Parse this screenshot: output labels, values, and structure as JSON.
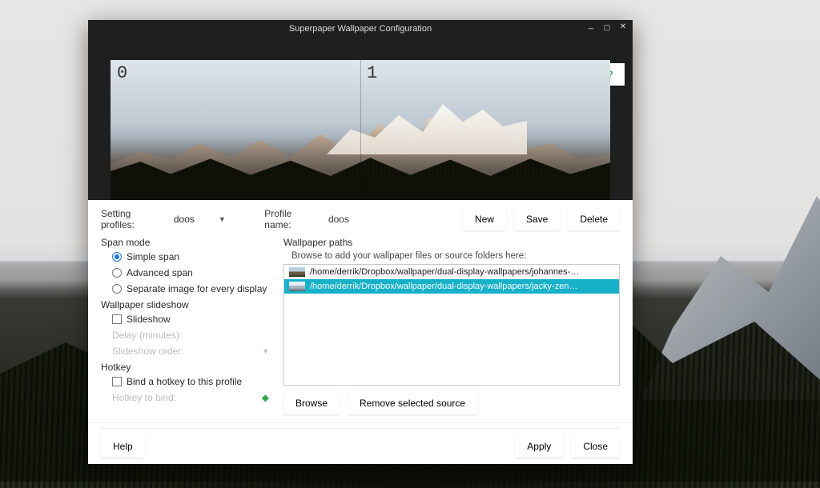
{
  "window": {
    "title": "Superpaper Wallpaper Configuration"
  },
  "preview": {
    "monitor_labels": [
      "0",
      "1"
    ],
    "help_icon": "?"
  },
  "profiles": {
    "label": "Setting profiles:",
    "selected": "doos",
    "name_label": "Profile name:",
    "name_value": "doos",
    "buttons": {
      "new": "New",
      "save": "Save",
      "delete": "Delete"
    }
  },
  "span": {
    "group_label": "Span mode",
    "options": [
      {
        "label": "Simple span",
        "selected": true
      },
      {
        "label": "Advanced span",
        "selected": false
      },
      {
        "label": "Separate image for every display",
        "selected": false
      }
    ]
  },
  "slideshow": {
    "group_label": "Wallpaper slideshow",
    "checkbox_label": "Slideshow",
    "checked": false,
    "delay_label": "Delay (minutes):",
    "order_label": "Slideshow order:"
  },
  "hotkey": {
    "group_label": "Hotkey",
    "checkbox_label": "Bind a hotkey to this profile",
    "checked": false,
    "bind_label": "Hotkey to bind:",
    "hint_icon": "◆"
  },
  "paths": {
    "group_label": "Wallpaper paths",
    "hint": "Browse to add your wallpaper files or source folders here:",
    "items": [
      {
        "path": "/home/derrik/Dropbox/wallpaper/dual-display-wallpapers/johannes-…",
        "selected": false
      },
      {
        "path": "/home/derrik/Dropbox/wallpaper/dual-display-wallpapers/jacky-zen…",
        "selected": true
      }
    ],
    "buttons": {
      "browse": "Browse",
      "remove": "Remove selected source"
    }
  },
  "footer": {
    "help": "Help",
    "apply": "Apply",
    "close": "Close"
  }
}
